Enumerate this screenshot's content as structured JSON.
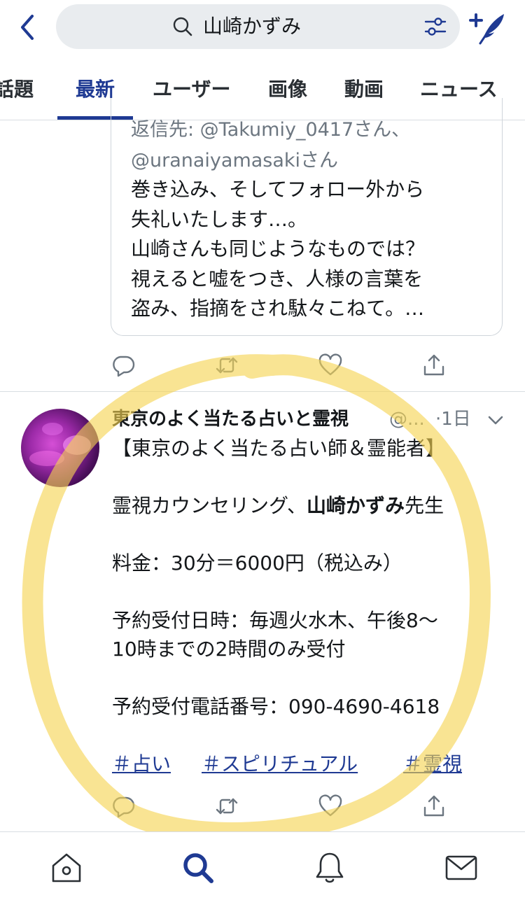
{
  "header": {
    "search_query": "山崎かずみ"
  },
  "tabs": [
    {
      "label": "話題"
    },
    {
      "label": "最新"
    },
    {
      "label": "ユーザー"
    },
    {
      "label": "画像"
    },
    {
      "label": "動画"
    },
    {
      "label": "ニュース"
    }
  ],
  "active_tab": "最新",
  "quoted": {
    "reply_to_line1": "返信先: @Takumiy_0417さん、",
    "reply_to_line2": "@uranaiyamasakiさん",
    "body_lines": [
      "巻き込み、そしてフォロー外から",
      "失礼いたします…。",
      "山崎さんも同じようなものでは？",
      "視えると嘘をつき、人様の言葉を",
      "盗み、指摘をされ駄々こねて。…"
    ]
  },
  "tweet": {
    "name": "東京のよく当たる占いと霊視",
    "handle": "@...",
    "time": "·1日",
    "line1": "【東京のよく当たる占い師＆霊能者】",
    "line2_pre": "霊視カウンセリング、",
    "line2_bold": "山崎かずみ",
    "line2_post": "先生",
    "line3": "料金：30分＝6000円（税込み）",
    "line4": "予約受付日時：毎週火水木、午後8〜",
    "line5": "10時までの2時間のみ受付",
    "line6": "予約受付電話番号：090-4690-4618",
    "hashtags": [
      "＃占い",
      "＃スピリチュアル",
      "＃霊視"
    ]
  },
  "icons": {
    "back": "chevron-left-icon",
    "search": "search-icon",
    "filter": "filter-sliders-icon",
    "compose": "compose-feather-icon",
    "reply": "reply-icon",
    "retweet": "retweet-icon",
    "like": "heart-icon",
    "share": "share-icon",
    "home": "home-icon",
    "explore": "search-icon",
    "notifications": "bell-icon",
    "messages": "mail-icon"
  },
  "colors": {
    "accent": "#1f3a93",
    "highlighter": "#f5d451",
    "muted_text": "#6c7680"
  }
}
